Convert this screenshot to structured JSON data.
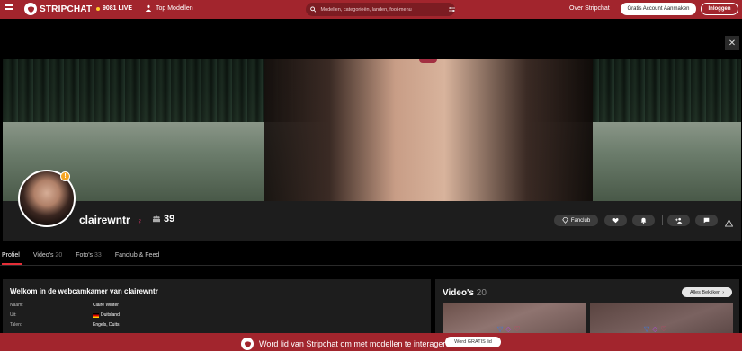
{
  "header": {
    "brand": "STRIPCHAT",
    "live_count": "9081 LIVE",
    "top_models": "Top Modellen",
    "search_placeholder": "Modellen, categorieën, landen, fooi-menu",
    "about": "Over Stripchat",
    "signup": "Gratis Account Aanmaken",
    "login": "Inloggen"
  },
  "profile": {
    "username": "clairewntr",
    "fan_count": "39",
    "buttons": {
      "fanclub": "Fanclub"
    }
  },
  "tabs": [
    {
      "label": "Profiel",
      "count": ""
    },
    {
      "label": "Video's",
      "count": "20"
    },
    {
      "label": "Foto's",
      "count": "33"
    },
    {
      "label": "Fanclub & Feed",
      "count": ""
    }
  ],
  "about_panel": {
    "title": "Welkom in de webcamkamer van clairewntr",
    "rows": [
      {
        "label": "Naam:",
        "value": "Claire Winter"
      },
      {
        "label": "Uit:",
        "value": "Duitsland"
      },
      {
        "label": "Talen:",
        "value": "Engels, Duits"
      }
    ]
  },
  "videos_panel": {
    "title": "Video's",
    "count": "20",
    "view_all": "Alles Bekijken"
  },
  "bottom_banner": {
    "text": "Word lid van Stripchat om met modellen te interageren.",
    "button": "Word GRATIS lid"
  },
  "colors": {
    "brand_red": "#a2252d",
    "accent_red": "#e52e37",
    "gender_pink": "#e2366a"
  }
}
